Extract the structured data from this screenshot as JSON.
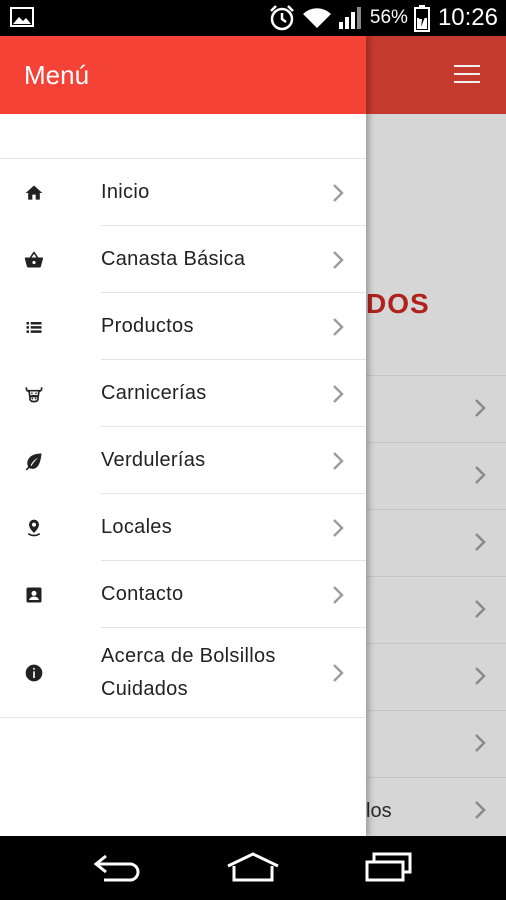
{
  "status_bar": {
    "gallery_icon": "image-icon",
    "alarm_icon": "alarm-icon",
    "wifi_icon": "wifi-icon",
    "signal_icon": "signal-icon",
    "battery_percent": "56%",
    "battery_icon": "battery-charging-icon",
    "time": "10:26"
  },
  "background": {
    "heading_fragment": "DOS",
    "rows": [
      {
        "text": ""
      },
      {
        "text": ""
      },
      {
        "text": ""
      },
      {
        "text": ""
      },
      {
        "text": ""
      },
      {
        "text": ""
      },
      {
        "text": "los"
      }
    ]
  },
  "drawer": {
    "title": "Menú",
    "items": [
      {
        "label": "Inicio",
        "icon": "home-icon"
      },
      {
        "label": "Canasta Básica",
        "icon": "basket-icon"
      },
      {
        "label": "Productos",
        "icon": "list-icon"
      },
      {
        "label": "Carnicerías",
        "icon": "cow-icon"
      },
      {
        "label": "Verdulerías",
        "icon": "leaf-icon"
      },
      {
        "label": "Locales",
        "icon": "location-pin-icon"
      },
      {
        "label": "Contacto",
        "icon": "contact-icon"
      },
      {
        "label": "Acerca de Bolsillos Cuidados",
        "icon": "info-icon"
      }
    ]
  },
  "nav_bar": {
    "back_icon": "back-icon",
    "home_icon": "home-nav-icon",
    "recents_icon": "recents-icon"
  },
  "colors": {
    "drawer_header": "#f44336",
    "app_header": "#c53a2f",
    "accent_text": "#b0211b"
  }
}
